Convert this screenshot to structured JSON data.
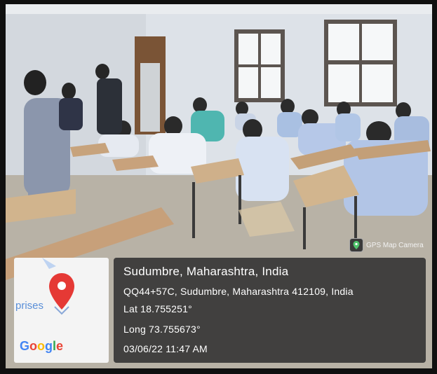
{
  "gps_badge": {
    "label": "GPS Map Camera"
  },
  "map": {
    "place_label": "prises",
    "logo_letters": [
      "G",
      "o",
      "o",
      "g",
      "l",
      "e"
    ]
  },
  "location": {
    "title": "Sudumbre, Maharashtra, India",
    "address": "QQ44+57C, Sudumbre, Maharashtra 412109, India",
    "lat": "Lat 18.755251°",
    "long": "Long 73.755673°",
    "datetime": "03/06/22 11:47 AM"
  },
  "colors": {
    "wall": "#dfe4ea",
    "desk": "#c9a27a",
    "overlay": "#1a1a1f"
  }
}
